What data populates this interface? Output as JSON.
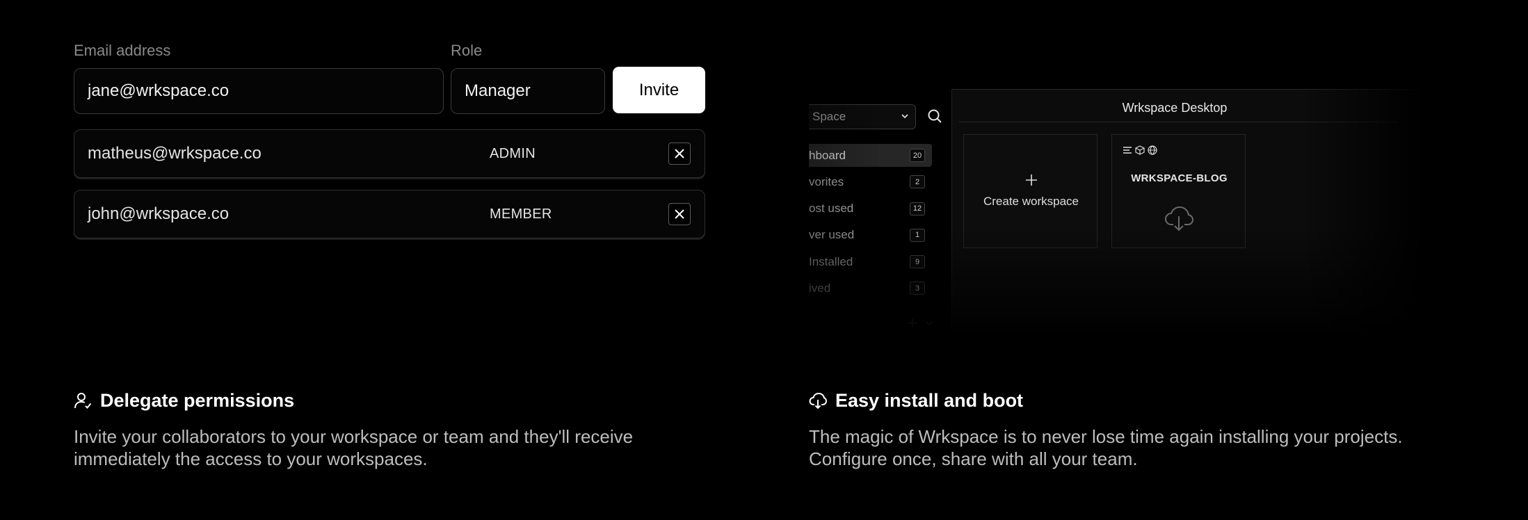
{
  "invite_form": {
    "email_label": "Email address",
    "role_label": "Role",
    "email_value": "jane@wrkspace.co",
    "role_value": "Manager",
    "invite_label": "Invite"
  },
  "members": [
    {
      "email": "matheus@wrkspace.co",
      "role": "ADMIN"
    },
    {
      "email": "john@wrkspace.co",
      "role": "MEMBER"
    }
  ],
  "desktop_preview": {
    "select_value": "Space",
    "window_title": "Wrkspace Desktop",
    "nav": [
      {
        "label": "hboard",
        "count": "20"
      },
      {
        "label": "vorites",
        "count": "2"
      },
      {
        "label": "ost used",
        "count": "12"
      },
      {
        "label": "ver used",
        "count": "1"
      },
      {
        "label": "Installed",
        "count": "9"
      },
      {
        "label": "ived",
        "count": "3"
      }
    ],
    "create_label": "Create workspace",
    "workspace_name": "WRKSPACE-BLOG"
  },
  "features": [
    {
      "title": "Delegate permissions",
      "description": "Invite your collaborators to your workspace or team and they'll receive immediately the access to your workspaces.",
      "icon": "user-icon"
    },
    {
      "title": "Easy install and boot",
      "description": "The magic of Wrkspace is to never lose time again installing your projects. Configure once, share with all your team.",
      "icon": "cloud-download-icon"
    }
  ],
  "colors": {
    "background": "#000000",
    "accent_button": "#ffffff",
    "muted_text": "#8a8a8a"
  }
}
